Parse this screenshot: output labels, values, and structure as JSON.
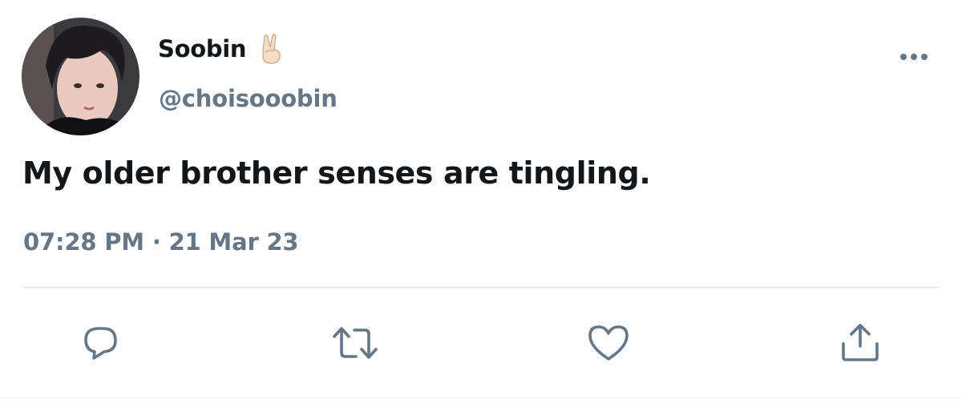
{
  "author": {
    "display_name": "Soobin",
    "name_emoji": "✌🏻",
    "handle": "@choisooobin"
  },
  "tweet": {
    "text": "My older brother senses are tingling.",
    "time": "07:28 PM",
    "separator": "·",
    "date": "21 Mar 23"
  },
  "icons": {
    "more": "more-dots-icon",
    "reply": "reply-bubble-icon",
    "retweet": "retweet-icon",
    "like": "heart-icon",
    "share": "share-upload-icon"
  },
  "colors": {
    "text_primary": "#14171a",
    "text_secondary": "#657786",
    "icon": "#657786",
    "divider": "#e6ecf0"
  }
}
